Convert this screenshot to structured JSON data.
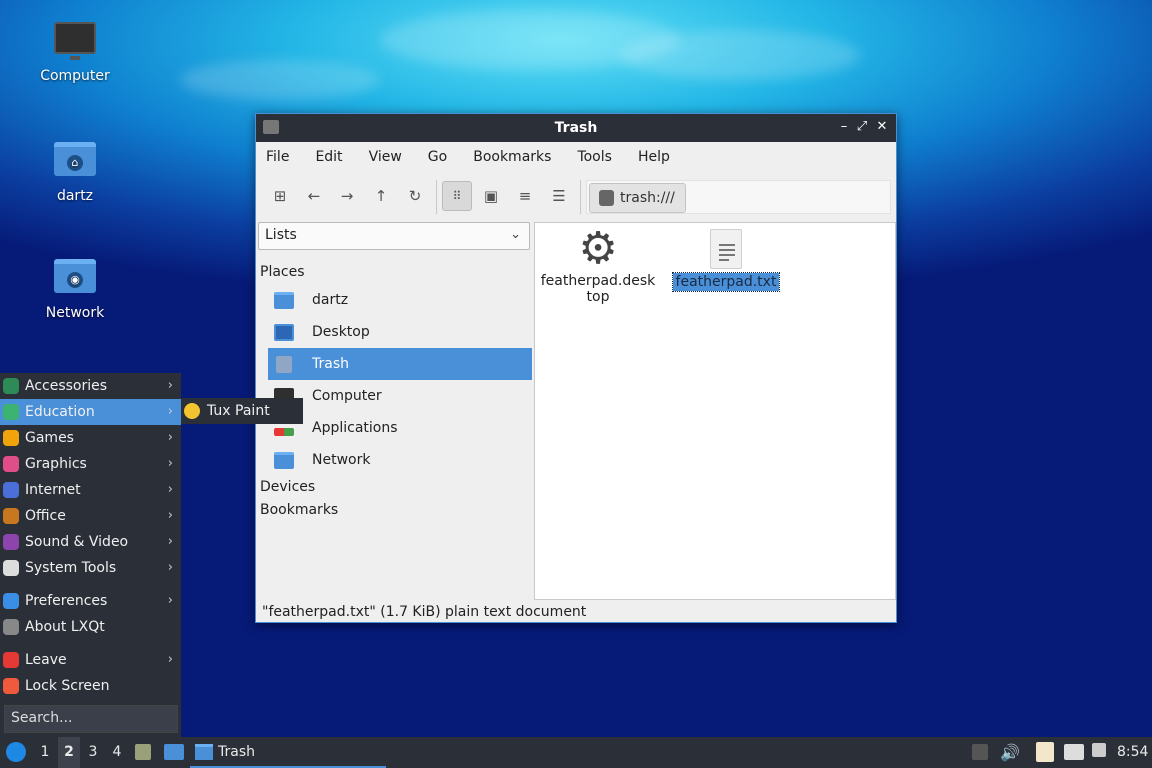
{
  "desktop": {
    "icons": [
      {
        "label": "Computer",
        "icon": "computer-icon"
      },
      {
        "label": "dartz",
        "icon": "home-folder-icon"
      },
      {
        "label": "Network",
        "icon": "network-folder-icon"
      }
    ]
  },
  "window": {
    "title": "Trash",
    "menu": [
      "File",
      "Edit",
      "View",
      "Go",
      "Bookmarks",
      "Tools",
      "Help"
    ],
    "location": "trash:///",
    "side_pane_mode": "Lists",
    "sections": {
      "places": "Places",
      "devices": "Devices",
      "bookmarks": "Bookmarks"
    },
    "places": [
      {
        "label": "dartz",
        "icon": "home-folder-icon",
        "selected": false
      },
      {
        "label": "Desktop",
        "icon": "desktop-icon",
        "selected": false
      },
      {
        "label": "Trash",
        "icon": "trash-icon",
        "selected": true
      },
      {
        "label": "Computer",
        "icon": "computer-icon",
        "selected": false
      },
      {
        "label": "Applications",
        "icon": "applications-icon",
        "selected": false
      },
      {
        "label": "Network",
        "icon": "network-icon",
        "selected": false
      }
    ],
    "files": [
      {
        "name_line1": "featherpad.desk",
        "name_line2": "top",
        "icon": "gear-icon",
        "selected": false
      },
      {
        "name": "featherpad.txt",
        "icon": "text-document-icon",
        "selected": true
      }
    ],
    "status": "\"featherpad.txt\" (1.7 KiB) plain text document"
  },
  "start_menu": {
    "items": [
      {
        "label": "Accessories",
        "color": "#2e8b57"
      },
      {
        "label": "Education",
        "color": "#3cb371",
        "highlighted": true
      },
      {
        "label": "Games",
        "color": "#f0a30a"
      },
      {
        "label": "Graphics",
        "color": "#e04e8a"
      },
      {
        "label": "Internet",
        "color": "#4a6fd9"
      },
      {
        "label": "Office",
        "color": "#c7781e"
      },
      {
        "label": "Sound & Video",
        "color": "#8e44ad"
      },
      {
        "label": "System Tools",
        "color": "#dddddd"
      }
    ],
    "items2": [
      {
        "label": "Preferences",
        "color": "#3a8ee6",
        "submenu": true
      },
      {
        "label": "About LXQt",
        "color": "#888888",
        "submenu": false
      }
    ],
    "items3": [
      {
        "label": "Leave",
        "color": "#e53935",
        "submenu": true
      },
      {
        "label": "Lock Screen",
        "color": "#ef5a3c",
        "submenu": false
      }
    ],
    "search_placeholder": "Search...",
    "submenu_item": "Tux Paint"
  },
  "taskbar": {
    "desktops": [
      "1",
      "2",
      "3",
      "4"
    ],
    "current_desktop": "2",
    "task_label": "Trash",
    "clock": "8:54"
  },
  "colors": {
    "accent": "#4a90d9",
    "panel": "#2b2f38"
  }
}
